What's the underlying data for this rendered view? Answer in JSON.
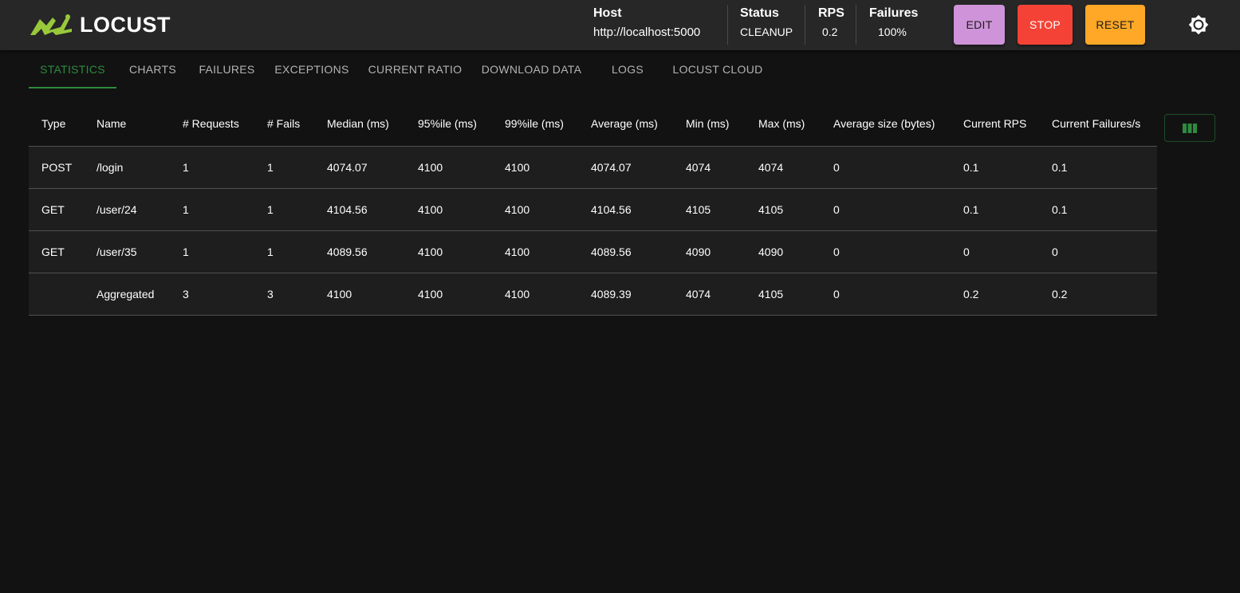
{
  "app": {
    "name": "LOCUST",
    "brand_color": "#99c93b"
  },
  "header": {
    "host": {
      "label": "Host",
      "value": "http://localhost:5000"
    },
    "status": {
      "label": "Status",
      "value": "CLEANUP"
    },
    "rps": {
      "label": "RPS",
      "value": "0.2"
    },
    "failures": {
      "label": "Failures",
      "value": "100%"
    },
    "buttons": {
      "edit": "EDIT",
      "stop": "STOP",
      "reset": "RESET"
    },
    "theme_icon": "sun-icon"
  },
  "tabs": [
    {
      "label": "STATISTICS",
      "active": true
    },
    {
      "label": "CHARTS"
    },
    {
      "label": "FAILURES"
    },
    {
      "label": "EXCEPTIONS"
    },
    {
      "label": "CURRENT RATIO"
    },
    {
      "label": "DOWNLOAD DATA"
    },
    {
      "label": "LOGS"
    },
    {
      "label": "LOCUST CLOUD"
    }
  ],
  "table": {
    "columns": [
      "Type",
      "Name",
      "# Requests",
      "# Fails",
      "Median (ms)",
      "95%ile (ms)",
      "99%ile (ms)",
      "Average (ms)",
      "Min (ms)",
      "Max (ms)",
      "Average size (bytes)",
      "Current RPS",
      "Current Failures/s"
    ],
    "rows": [
      [
        "POST",
        "/login",
        "1",
        "1",
        "4074.07",
        "4100",
        "4100",
        "4074.07",
        "4074",
        "4074",
        "0",
        "0.1",
        "0.1"
      ],
      [
        "GET",
        "/user/24",
        "1",
        "1",
        "4104.56",
        "4100",
        "4100",
        "4104.56",
        "4105",
        "4105",
        "0",
        "0.1",
        "0.1"
      ],
      [
        "GET",
        "/user/35",
        "1",
        "1",
        "4089.56",
        "4100",
        "4100",
        "4089.56",
        "4090",
        "4090",
        "0",
        "0",
        "0"
      ],
      [
        "",
        "Aggregated",
        "3",
        "3",
        "4100",
        "4100",
        "4100",
        "4089.39",
        "4074",
        "4105",
        "0",
        "0.2",
        "0.2"
      ]
    ],
    "column_selector_icon": "view-column-icon",
    "accent_color": "#2e8b3e"
  }
}
